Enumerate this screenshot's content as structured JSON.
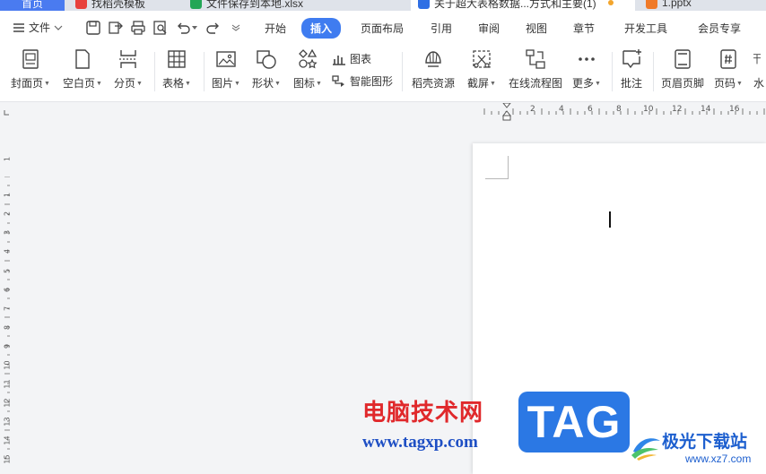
{
  "tabs": [
    {
      "label": "首页"
    },
    {
      "label": "找稻壳模板"
    },
    {
      "label": "文件保存到本地.xlsx"
    },
    {
      "label": "关于超大表格数据...方式和主要(1)"
    },
    {
      "label": "1.pptx"
    }
  ],
  "menu": {
    "file_label": "文件",
    "tabs": [
      "开始",
      "插入",
      "页面布局",
      "引用",
      "审阅",
      "视图",
      "章节",
      "开发工具",
      "会员专享"
    ]
  },
  "ribbon": {
    "cover": "封面页",
    "blank": "空白页",
    "page_break": "分页",
    "table": "表格",
    "picture": "图片",
    "shape": "形状",
    "icon": "图标",
    "chart": "图表",
    "smart_graphic": "智能图形",
    "docer_resources": "稻壳资源",
    "screenshot": "截屏",
    "flowchart": "在线流程图",
    "more": "更多",
    "comment": "批注",
    "header_footer": "页眉页脚",
    "page_number": "页码",
    "watermark": "水"
  },
  "ruler": {
    "h_ticks": [
      "2",
      "4",
      "6",
      "8",
      "10",
      "12",
      "14",
      "16"
    ],
    "v_ticks": [
      "1",
      "1",
      "2",
      "3",
      "4",
      "5",
      "6",
      "7",
      "8",
      "9",
      "10",
      "11",
      "12",
      "13",
      "14",
      "15"
    ]
  },
  "watermark": {
    "cn_title": "电脑技术网",
    "url": "www.tagxp.com",
    "tag": "TAG",
    "xz_cn": "极光下载站",
    "xz_url": "www.xz7.com"
  },
  "colors": {
    "accent": "#3f7cf0",
    "tab_home": "#4a7bf0",
    "watermark_red": "#e0282b",
    "watermark_blue": "#2b78e4"
  }
}
